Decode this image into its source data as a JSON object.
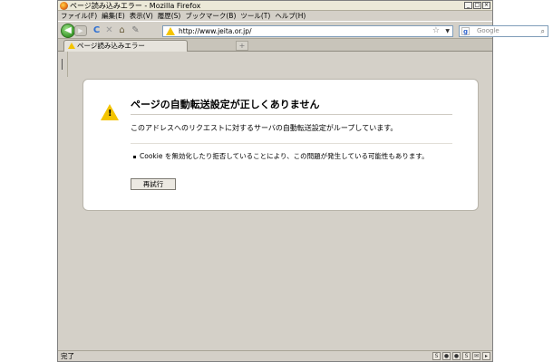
{
  "window": {
    "title": "ページ読み込みエラー - Mozilla Firefox",
    "buttons": {
      "minimize": "_",
      "maximize": "□",
      "close": "×"
    }
  },
  "menubar": {
    "items": [
      {
        "label": "ファイル(F)"
      },
      {
        "label": "編集(E)"
      },
      {
        "label": "表示(V)"
      },
      {
        "label": "履歴(S)"
      },
      {
        "label": "ブックマーク(B)"
      },
      {
        "label": "ツール(T)"
      },
      {
        "label": "ヘルプ(H)"
      }
    ]
  },
  "navbar": {
    "back": "◀",
    "forward": "▶",
    "reload": "C",
    "stop": "✕",
    "home": "⌂",
    "url": "http://www.jeita.or.jp/",
    "bookmark_star": "☆",
    "dropdown": "▼",
    "search_engine": "g",
    "search_placeholder": "Google",
    "search_icon": "⌕"
  },
  "tabs": [
    {
      "title": "ページ読み込みエラー",
      "icon": "warning-icon",
      "active": true
    }
  ],
  "newtab": "+",
  "error": {
    "icon": "warning-icon",
    "icon_mark": "!",
    "title": "ページの自動転送設定が正しくありません",
    "description": "このアドレスへのリクエストに対するサーバの自動転送設定がループしています。",
    "bullet": "Cookie を無効化したり拒否していることにより、この問題が発生している可能性もあります。",
    "retry_label": "再試行"
  },
  "statusbar": {
    "text": "完了",
    "icons": [
      "S",
      "●",
      "●",
      "S",
      "✉",
      "▸"
    ]
  },
  "colors": {
    "chrome": "#d4d0c8",
    "warning": "#f4c400",
    "page_bg": "#ffffff"
  }
}
